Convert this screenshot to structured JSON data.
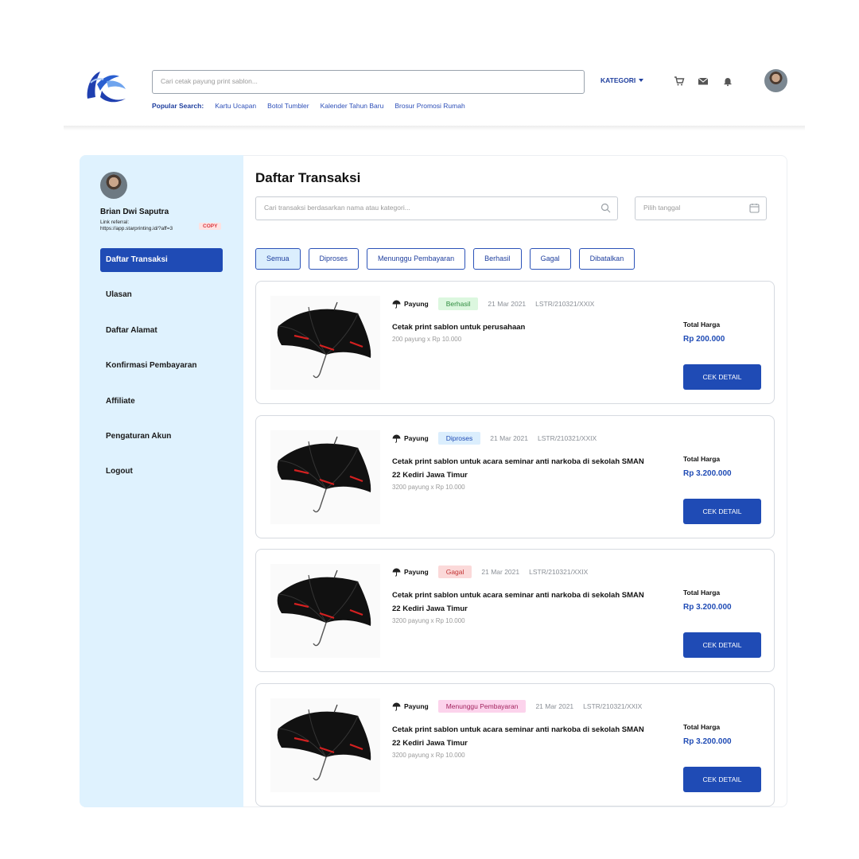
{
  "header": {
    "search_placeholder": "Cari cetak payung print sablon...",
    "popular_label": "Popular Search:",
    "popular_links": [
      "Kartu Ucapan",
      "Botol Tumbler",
      "Kalender Tahun Baru",
      "Brosur Promosi Rumah"
    ],
    "kategori_label": "KATEGORI",
    "icons": [
      "cart-icon",
      "mail-icon",
      "bell-icon"
    ]
  },
  "sidebar": {
    "user_name": "Brian Dwi Saputra",
    "referral_label": "Link referral:",
    "referral_url": "https://app.starprinting.id/?aff=3",
    "copy_label": "COPY",
    "items": [
      {
        "label": "Daftar Transaksi",
        "active": true
      },
      {
        "label": "Ulasan",
        "active": false
      },
      {
        "label": "Daftar Alamat",
        "active": false
      },
      {
        "label": "Konfirmasi Pembayaran",
        "active": false
      },
      {
        "label": "Affiliate",
        "active": false
      },
      {
        "label": "Pengaturan Akun",
        "active": false
      },
      {
        "label": "Logout",
        "active": false
      }
    ]
  },
  "main": {
    "title": "Daftar Transaksi",
    "search_placeholder": "Cari transaksi berdasarkan nama atau kategori...",
    "date_placeholder": "Pilih tanggal",
    "filters": [
      {
        "label": "Semua",
        "active": true
      },
      {
        "label": "Diproses",
        "active": false
      },
      {
        "label": "Menunggu Pembayaran",
        "active": false
      },
      {
        "label": "Berhasil",
        "active": false
      },
      {
        "label": "Gagal",
        "active": false
      },
      {
        "label": "Dibatalkan",
        "active": false
      }
    ],
    "transactions": [
      {
        "category": "Payung",
        "status": "Berhasil",
        "status_bg": "#dcf7df",
        "status_color": "#2e8b3e",
        "date": "21 Mar 2021",
        "code": "LSTR/210321/XXIX",
        "title": "Cetak print sablon untuk perusahaan",
        "qty": "200 payung x Rp 10.000",
        "total_label": "Total Harga",
        "total": "Rp 200.000",
        "button": "CEK DETAIL"
      },
      {
        "category": "Payung",
        "status": "Diproses",
        "status_bg": "#dbeefd",
        "status_color": "#1f4bb5",
        "date": "21 Mar 2021",
        "code": "LSTR/210321/XXIX",
        "title": "Cetak print sablon untuk acara seminar anti narkoba di sekolah SMAN 22 Kediri Jawa Timur",
        "qty": "3200 payung x Rp 10.000",
        "total_label": "Total Harga",
        "total": "Rp 3.200.000",
        "button": "CEK DETAIL"
      },
      {
        "category": "Payung",
        "status": "Gagal",
        "status_bg": "#fbd9d9",
        "status_color": "#c23434",
        "date": "21 Mar 2021",
        "code": "LSTR/210321/XXIX",
        "title": "Cetak print sablon untuk acara seminar anti narkoba di sekolah SMAN 22 Kediri Jawa Timur",
        "qty": "3200 payung x Rp 10.000",
        "total_label": "Total Harga",
        "total": "Rp 3.200.000",
        "button": "CEK DETAIL"
      },
      {
        "category": "Payung",
        "status": "Menunggu Pembayaran",
        "status_bg": "#fcd3ec",
        "status_color": "#a3245f",
        "date": "21 Mar 2021",
        "code": "LSTR/210321/XXIX",
        "title": "Cetak print sablon untuk acara seminar anti narkoba di sekolah SMAN 22 Kediri Jawa Timur",
        "qty": "3200 payung x Rp 10.000",
        "total_label": "Total Harga",
        "total": "Rp 3.200.000",
        "button": "CEK DETAIL"
      }
    ]
  }
}
